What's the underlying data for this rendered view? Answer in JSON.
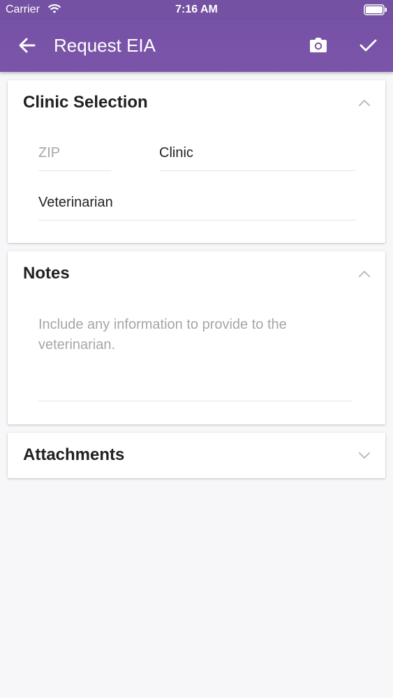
{
  "status_bar": {
    "carrier": "Carrier",
    "time": "7:16 AM"
  },
  "app_bar": {
    "title": "Request EIA",
    "color": "#7752a6",
    "back_icon": "arrow-left-icon",
    "camera_icon": "camera-icon",
    "confirm_icon": "check-icon"
  },
  "clinic_selection": {
    "title": "Clinic Selection",
    "expanded": true,
    "zip_placeholder": "ZIP",
    "clinic_value": "Clinic",
    "veterinarian_value": "Veterinarian"
  },
  "notes": {
    "title": "Notes",
    "expanded": true,
    "placeholder": "Include any information to provide to the veterinarian."
  },
  "attachments": {
    "title": "Attachments",
    "expanded": false
  }
}
